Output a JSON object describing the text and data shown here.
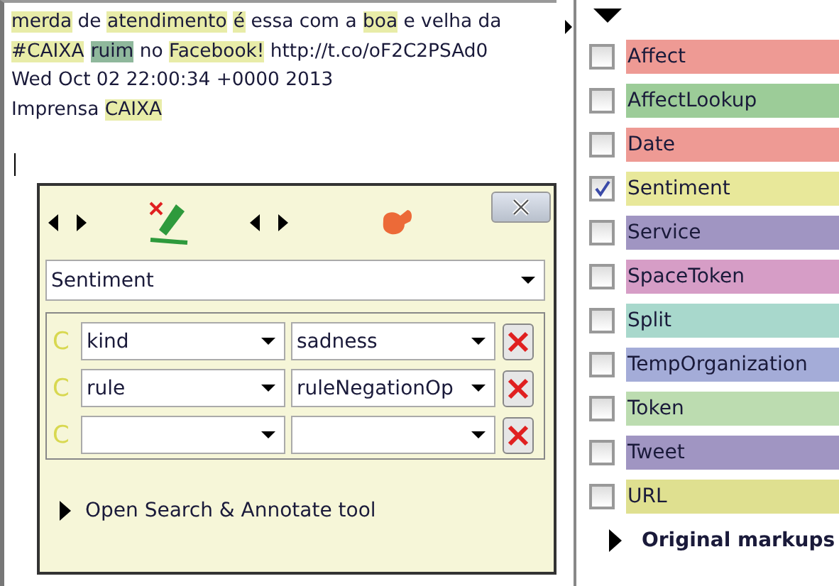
{
  "document_text": {
    "lines": [
      [
        {
          "text": "merda",
          "color": "#e8eca8"
        },
        {
          "text": " de "
        },
        {
          "text": "atendimento",
          "color": "#e8eca8",
          "space_after": true
        },
        {
          "text": "é",
          "color": "#e8eca8"
        },
        {
          "text": " essa com a "
        },
        {
          "text": "boa",
          "color": "#e8eca8"
        },
        {
          "text": " e velha da"
        }
      ],
      [
        {
          "text": "#CAIXA",
          "color": "#e8eca8",
          "space_after": true
        },
        {
          "text": "ruim",
          "color": "#8fb89c"
        },
        {
          "text": " no "
        },
        {
          "text": "Facebook!",
          "color": "#e8eca8"
        },
        {
          "text": " http://t.co/oF2C2PSAd0"
        }
      ],
      [
        {
          "text": "Wed Oct 02 22:00:34 +0000 2013"
        }
      ],
      [
        {
          "text": "Imprensa "
        },
        {
          "text": "CAIXA",
          "color": "#e8eca8"
        }
      ]
    ]
  },
  "annotation_editor": {
    "type_select": {
      "value": "Sentiment"
    },
    "features": [
      {
        "marker": "C",
        "name": "kind",
        "value": "sadness"
      },
      {
        "marker": "C",
        "name": "rule",
        "value": "ruleNegationOp"
      },
      {
        "marker": "C"
      }
    ],
    "open_tool": {
      "label": "Open Search & Annotate tool"
    }
  },
  "annotation_types": [
    {
      "label": "Affect",
      "color": "#ee9a94",
      "checked": false
    },
    {
      "label": "AffectLookup",
      "color": "#9ccc98",
      "checked": false
    },
    {
      "label": "Date",
      "color": "#ee9a94",
      "checked": false
    },
    {
      "label": "Sentiment",
      "color": "#e8e89a",
      "checked": true
    },
    {
      "label": "Service",
      "color": "#a095c2",
      "checked": false
    },
    {
      "label": "SpaceToken",
      "color": "#d69dc6",
      "checked": false
    },
    {
      "label": "Split",
      "color": "#a8d8cc",
      "checked": false
    },
    {
      "label": "TempOrganization",
      "color": "#a4acd8",
      "checked": false
    },
    {
      "label": "Token",
      "color": "#bcdcb0",
      "checked": false
    },
    {
      "label": "Tweet",
      "color": "#a095c2",
      "checked": false
    },
    {
      "label": "URL",
      "color": "#dfe090",
      "checked": false
    }
  ],
  "original_markups": {
    "label": "Original markups",
    "expanded": false
  }
}
